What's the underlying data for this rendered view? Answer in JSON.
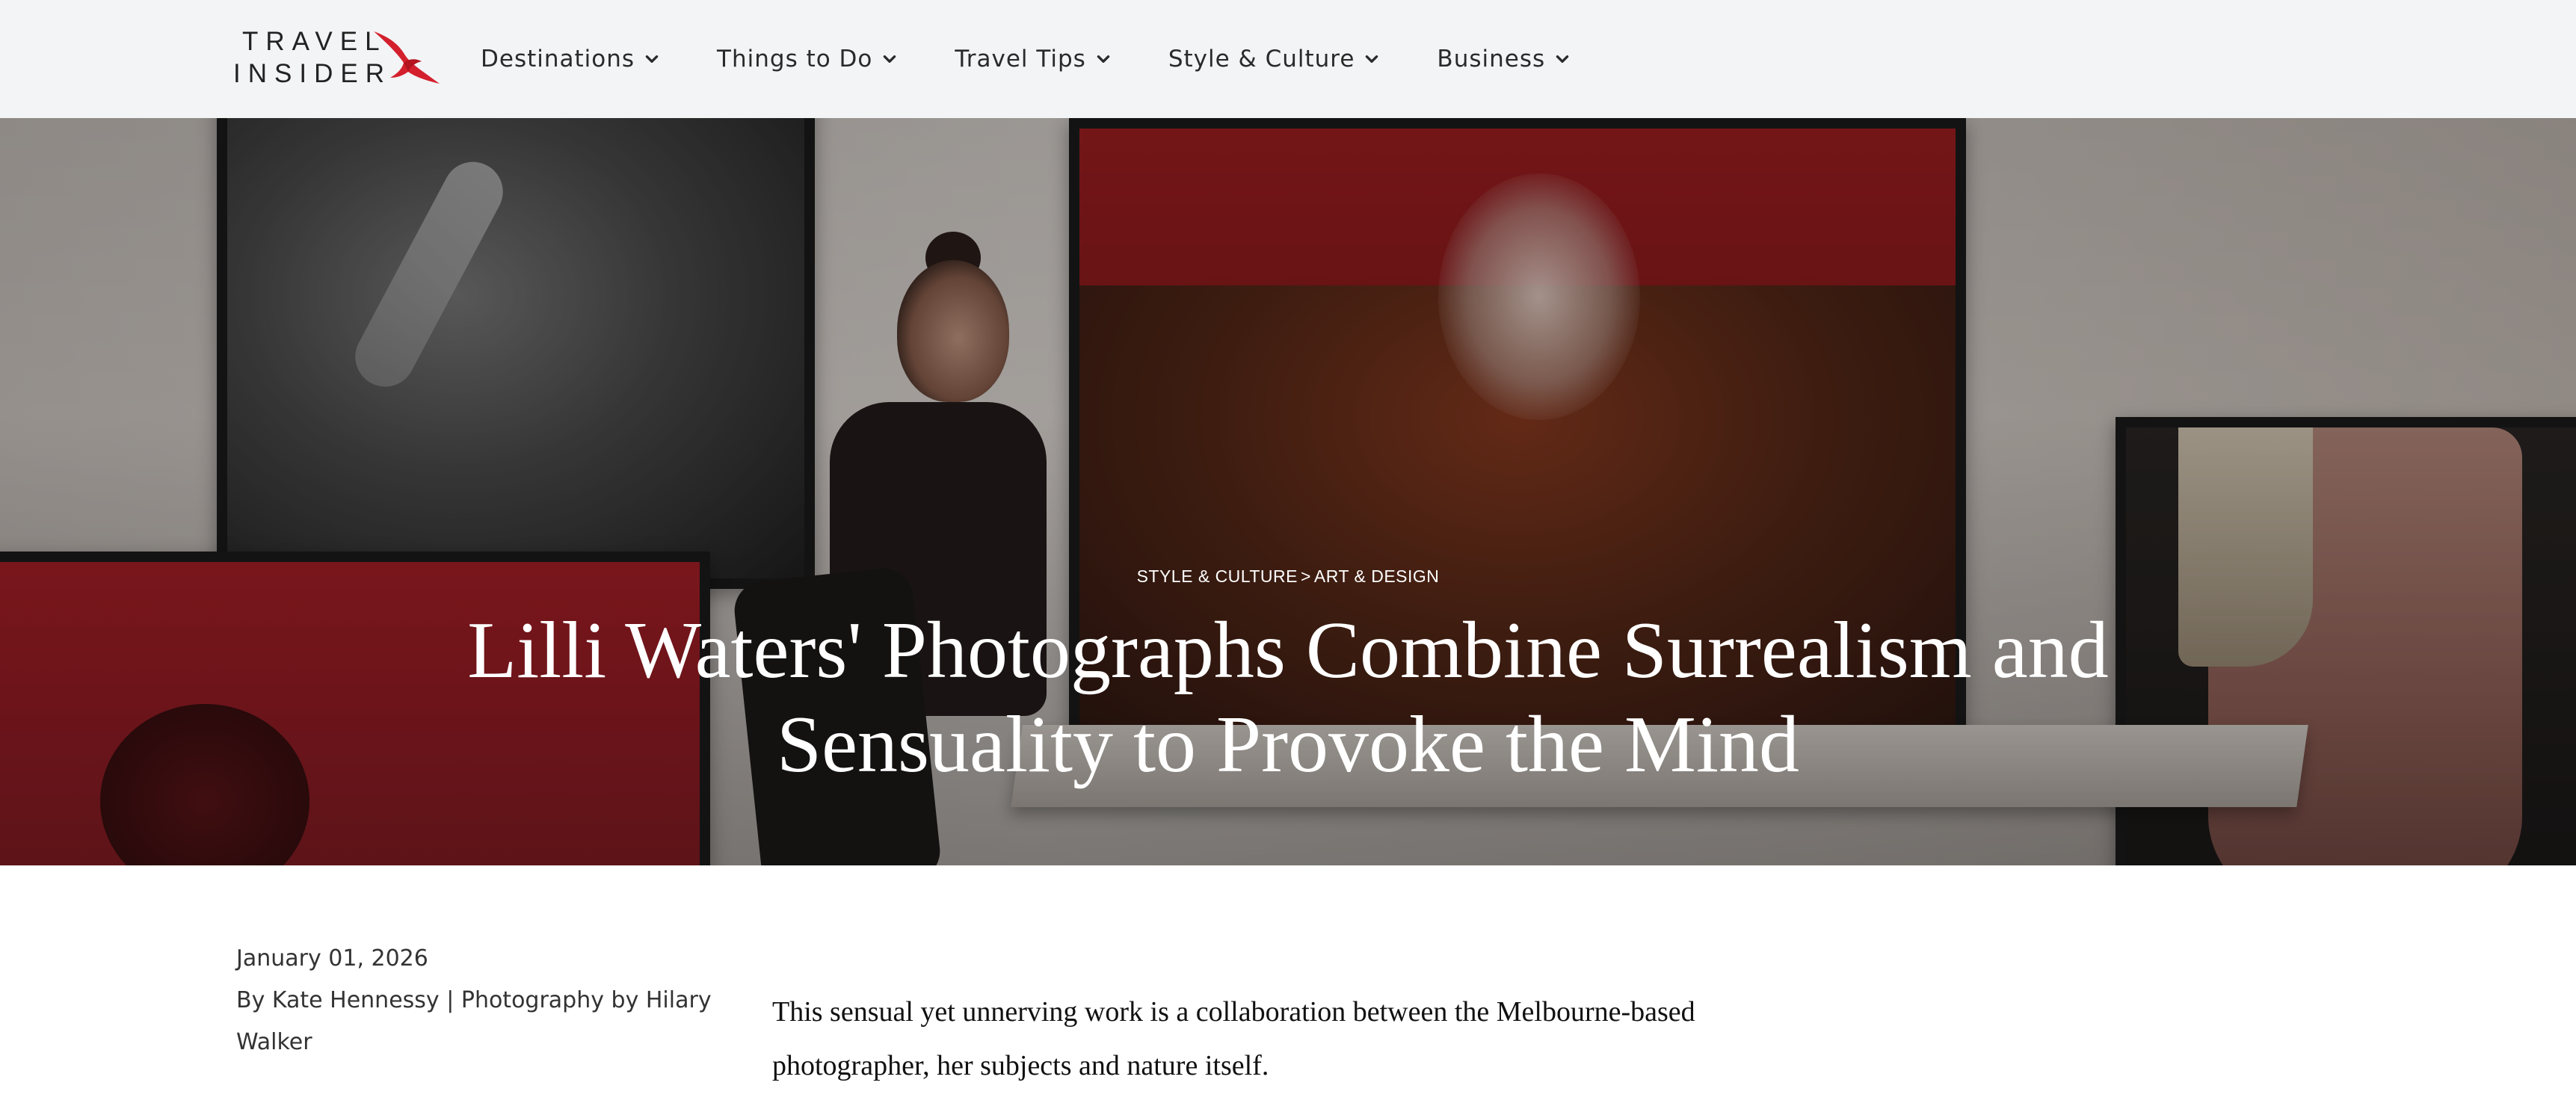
{
  "brand": {
    "line1": "TRAVEL",
    "line2": "INSIDER",
    "accent_color": "#d4202d"
  },
  "nav": {
    "items": [
      {
        "label": "Destinations",
        "icon": "chevron-down-icon"
      },
      {
        "label": "Things to Do",
        "icon": "chevron-down-icon"
      },
      {
        "label": "Travel Tips",
        "icon": "chevron-down-icon"
      },
      {
        "label": "Style & Culture",
        "icon": "chevron-down-icon"
      },
      {
        "label": "Business",
        "icon": "chevron-down-icon"
      }
    ]
  },
  "article": {
    "breadcrumb": {
      "section": "STYLE & CULTURE",
      "separator": ">",
      "subsection": "ART & DESIGN"
    },
    "title": "Lilli Waters' Photographs Combine Surrealism and Sensuality to Provoke the Mind",
    "date": "January 01, 2026",
    "byline": "By Kate Hennessy | Photography by Hilary Walker",
    "intro": "This sensual yet unnerving work is a collaboration between the Melbourne-based photographer, her subjects and nature itself."
  },
  "colors": {
    "nav_background": "#f3f4f6",
    "text_primary": "#222222",
    "hero_text": "#ffffff"
  }
}
